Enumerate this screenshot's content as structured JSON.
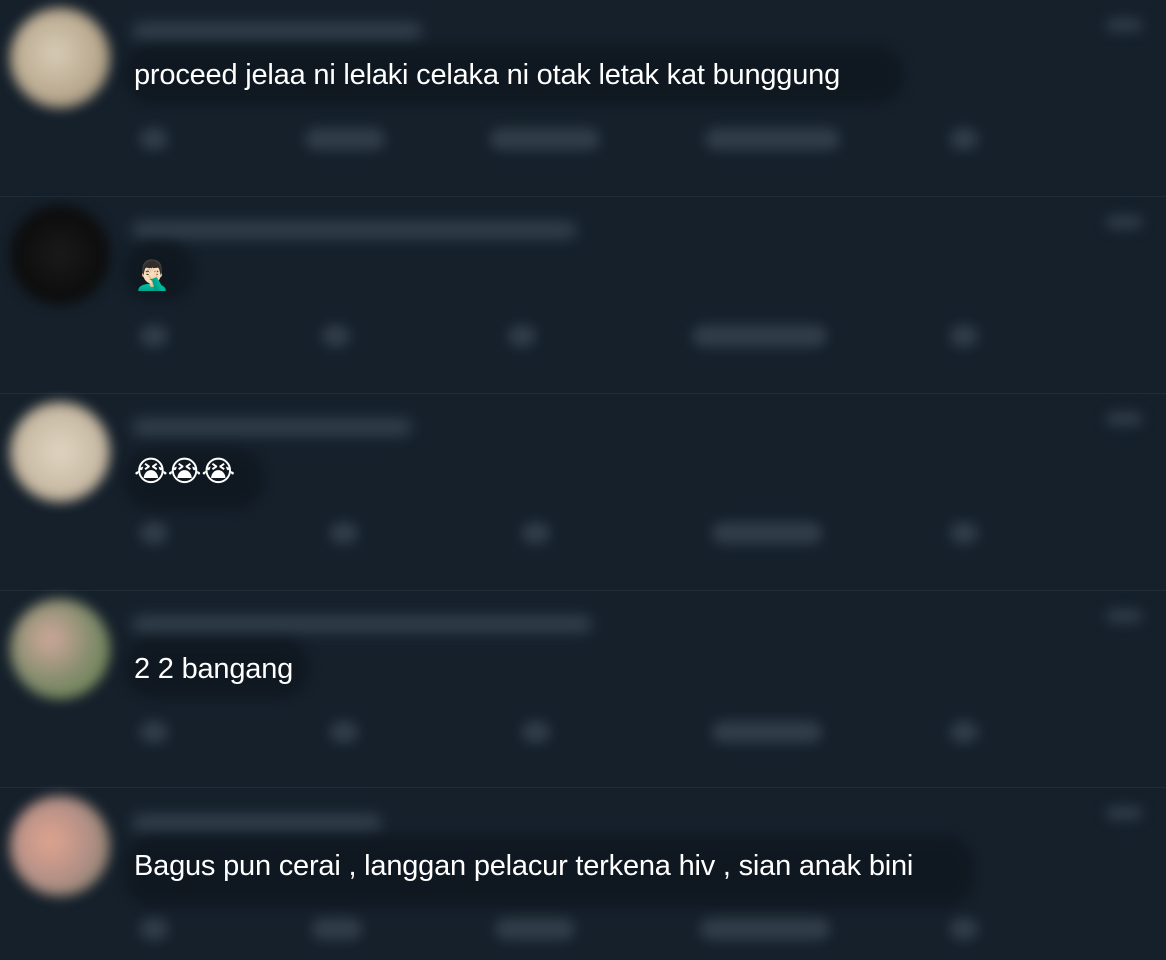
{
  "replies": [
    {
      "text": "proceed jelaa ni lelaki celaka ni otak letak kat bunggung",
      "avatar_color": "#b9a98f"
    },
    {
      "text": "🤦🏻‍♂️",
      "avatar_color": "#0d0d0d"
    },
    {
      "text": "😭😭😭",
      "avatar_color": "#c9bba5"
    },
    {
      "text": "2 2 bangang",
      "avatar_color": "#7e8a6a"
    },
    {
      "text": "Bagus pun cerai , langgan pelacur terkena hiv , sian anak bini",
      "avatar_color": "#b28f86"
    }
  ],
  "icons": {
    "reply": "reply-icon",
    "retweet": "retweet-icon",
    "like": "like-icon",
    "views": "views-icon",
    "share": "share-icon",
    "more": "more-icon"
  }
}
